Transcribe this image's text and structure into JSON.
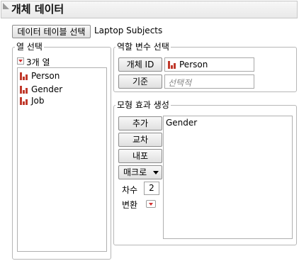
{
  "header": {
    "title": "개체 데이터"
  },
  "toolbar": {
    "select_table_label": "데이터 테이블 선택",
    "table_name": "Laptop Subjects"
  },
  "columns": {
    "legend": "열 선택",
    "count_label": "3개 열",
    "items": [
      {
        "label": "Person"
      },
      {
        "label": "Gender"
      },
      {
        "label": "Job"
      }
    ]
  },
  "roles": {
    "legend": "역할 변수 선택",
    "subject_id_label": "개체 ID",
    "subject_id_value": "Person",
    "basis_label": "기준",
    "basis_placeholder": "선택적"
  },
  "effects": {
    "legend": "모형 효과 생성",
    "add_label": "추가",
    "cross_label": "교차",
    "nest_label": "내포",
    "macro_label": "매크로",
    "degree_label": "차수",
    "degree_value": "2",
    "transform_label": "변환",
    "items": [
      "Gender"
    ]
  },
  "colors": {
    "icon_red": "#c0392b",
    "arrow_red": "#d23030"
  }
}
